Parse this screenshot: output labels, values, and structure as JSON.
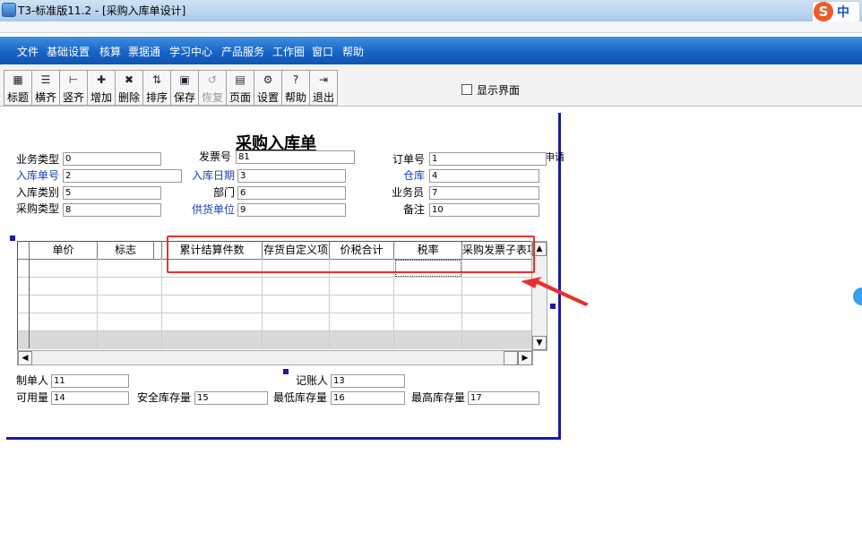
{
  "window": {
    "title": "T3-标准版11.2 - [采购入库单设计]"
  },
  "ime": {
    "logo": "S",
    "mode": "中"
  },
  "menu": [
    "文件",
    "基础设置",
    "核算",
    "票据通",
    "学习中心",
    "产品服务",
    "工作圈",
    "窗口",
    "帮助"
  ],
  "toolbar": {
    "buttons": [
      {
        "label": "标题",
        "icon": "title-icon"
      },
      {
        "label": "横齐",
        "icon": "align-horizontal-icon"
      },
      {
        "label": "竖齐",
        "icon": "align-vertical-icon"
      },
      {
        "label": "增加",
        "icon": "add-icon"
      },
      {
        "label": "删除",
        "icon": "delete-icon"
      },
      {
        "label": "排序",
        "icon": "sort-icon"
      },
      {
        "label": "保存",
        "icon": "save-icon"
      },
      {
        "label": "恢复",
        "icon": "restore-icon",
        "disabled": true
      },
      {
        "label": "页面",
        "icon": "page-icon"
      },
      {
        "label": "设置",
        "icon": "settings-icon"
      },
      {
        "label": "帮助",
        "icon": "help-icon"
      },
      {
        "label": "退出",
        "icon": "exit-icon"
      }
    ],
    "show_interface_label": "显示界面"
  },
  "form": {
    "title": "采购入库单",
    "fields": [
      {
        "label": "业务类型",
        "value": "0",
        "blue": false
      },
      {
        "label": "发票号",
        "value": "81",
        "blue": false
      },
      {
        "label": "订单号",
        "value": "1",
        "blue": false
      },
      {
        "label": "入库单号",
        "value": "2",
        "blue": true
      },
      {
        "label": "入库日期",
        "value": "3",
        "blue": true
      },
      {
        "label": "仓库",
        "value": "4",
        "blue": true
      },
      {
        "label": "入库类别",
        "value": "5",
        "blue": false
      },
      {
        "label": "部门",
        "value": "6",
        "blue": false
      },
      {
        "label": "业务员",
        "value": "7",
        "blue": false
      },
      {
        "label": "采购类型",
        "value": "8",
        "blue": false
      },
      {
        "label": "供货单位",
        "value": "9",
        "blue": true
      },
      {
        "label": "备注",
        "value": "10",
        "blue": false
      }
    ],
    "cut_text": "申请",
    "grid": {
      "columns": [
        "",
        "单价",
        "标志",
        "",
        "累计结算件数",
        "存货自定义项",
        "价税合计",
        "税率",
        "采购发票子表项"
      ]
    },
    "footer": [
      {
        "label": "制单人",
        "value": "11"
      },
      {
        "label": "记账人",
        "value": "13"
      },
      {
        "label": "可用量",
        "value": "14"
      },
      {
        "label": "安全库存量",
        "value": "15"
      },
      {
        "label": "最低库存量",
        "value": "16"
      },
      {
        "label": "最高库存量",
        "value": "17"
      }
    ]
  },
  "colors": {
    "menu_bg": "#1765c8",
    "highlight": "#e8312d",
    "design_border": "#1a1aa0",
    "required_label": "#1a3fb8"
  }
}
